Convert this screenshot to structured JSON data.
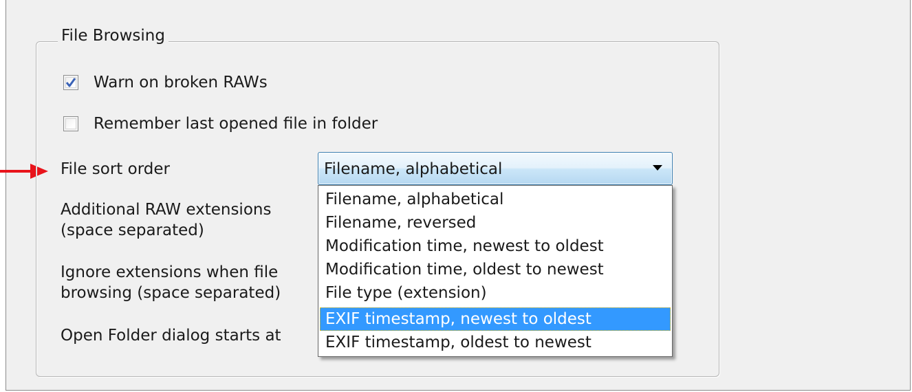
{
  "group": {
    "title": "File Browsing"
  },
  "checkboxes": [
    {
      "label": "Warn on broken RAWs",
      "checked": true
    },
    {
      "label": "Remember last opened file in folder",
      "checked": false
    }
  ],
  "labels": {
    "sort_order": "File sort order",
    "raw_ext_line1": "Additional RAW extensions",
    "raw_ext_line2": "(space separated)",
    "ignore_ext_line1": "Ignore extensions when file",
    "ignore_ext_line2": "browsing (space separated)",
    "open_folder": "Open Folder dialog starts at"
  },
  "sort_combo": {
    "value": "Filename, alphabetical",
    "options": [
      "Filename, alphabetical",
      "Filename, reversed",
      "Modification time, newest to oldest",
      "Modification time, oldest to newest",
      "File type (extension)",
      "EXIF timestamp, newest to oldest",
      "EXIF timestamp, oldest to newest"
    ],
    "highlighted_index": 5
  },
  "colors": {
    "annotation_arrow": "#e8141b",
    "highlight": "#3399ff",
    "check_mark": "#3a62b6"
  }
}
